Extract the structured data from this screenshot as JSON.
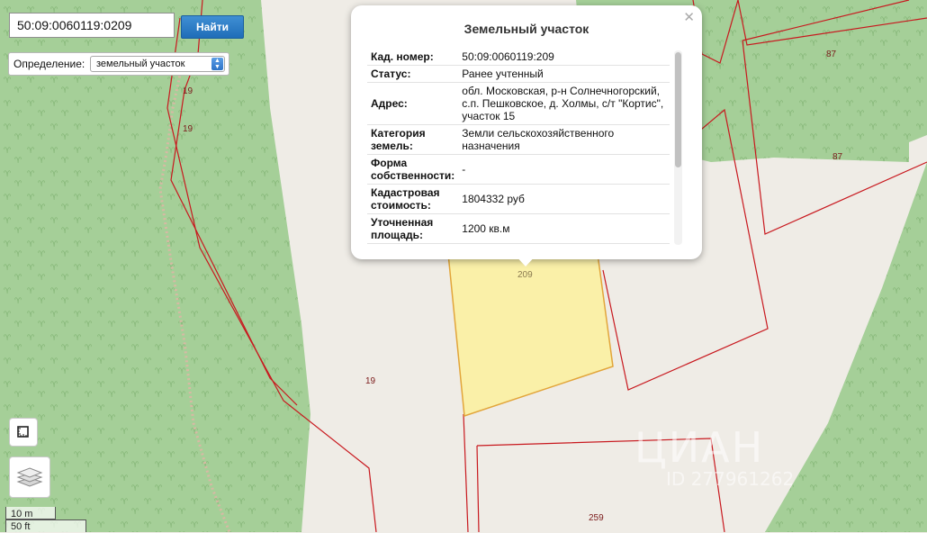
{
  "search": {
    "value": "50:09:0060119:0209",
    "button_label": "Найти"
  },
  "definition": {
    "label": "Определение:",
    "selected": "земельный участок"
  },
  "popup": {
    "title": "Земельный участок",
    "rows": [
      {
        "key": "Кад. номер:",
        "value": "50:09:0060119:209"
      },
      {
        "key": "Статус:",
        "value": "Ранее учтенный"
      },
      {
        "key": "Адрес:",
        "value": "обл. Московская, р-н Солнечногорский, с.п. Пешковское, д. Холмы, с/т \"Кортис\", участок 15"
      },
      {
        "key": "Категория земель:",
        "value": "Земли сельскохозяйственного назначения"
      },
      {
        "key": "Форма собственности:",
        "value": "-"
      },
      {
        "key": "Кадастровая стоимость:",
        "value": "1804332 руб"
      },
      {
        "key": "Уточненная площадь:",
        "value": "1200 кв.м"
      }
    ]
  },
  "map": {
    "parcel_labels": {
      "p19a": "19",
      "p19b": "19",
      "p19c": "19",
      "p209": "209",
      "p87a": "87",
      "p87b": "87",
      "p259": "259"
    }
  },
  "scale": {
    "metric": "10 m",
    "imperial": "50 ft"
  },
  "watermark": {
    "brand": "ЦИАН",
    "id": "ID 277961262"
  },
  "colors": {
    "forest": "#a5cf98",
    "ground": "#efece6",
    "parcel_border": "#c8181e",
    "selected_parcel": "#faf0a8",
    "button": "#2a7cc7"
  }
}
